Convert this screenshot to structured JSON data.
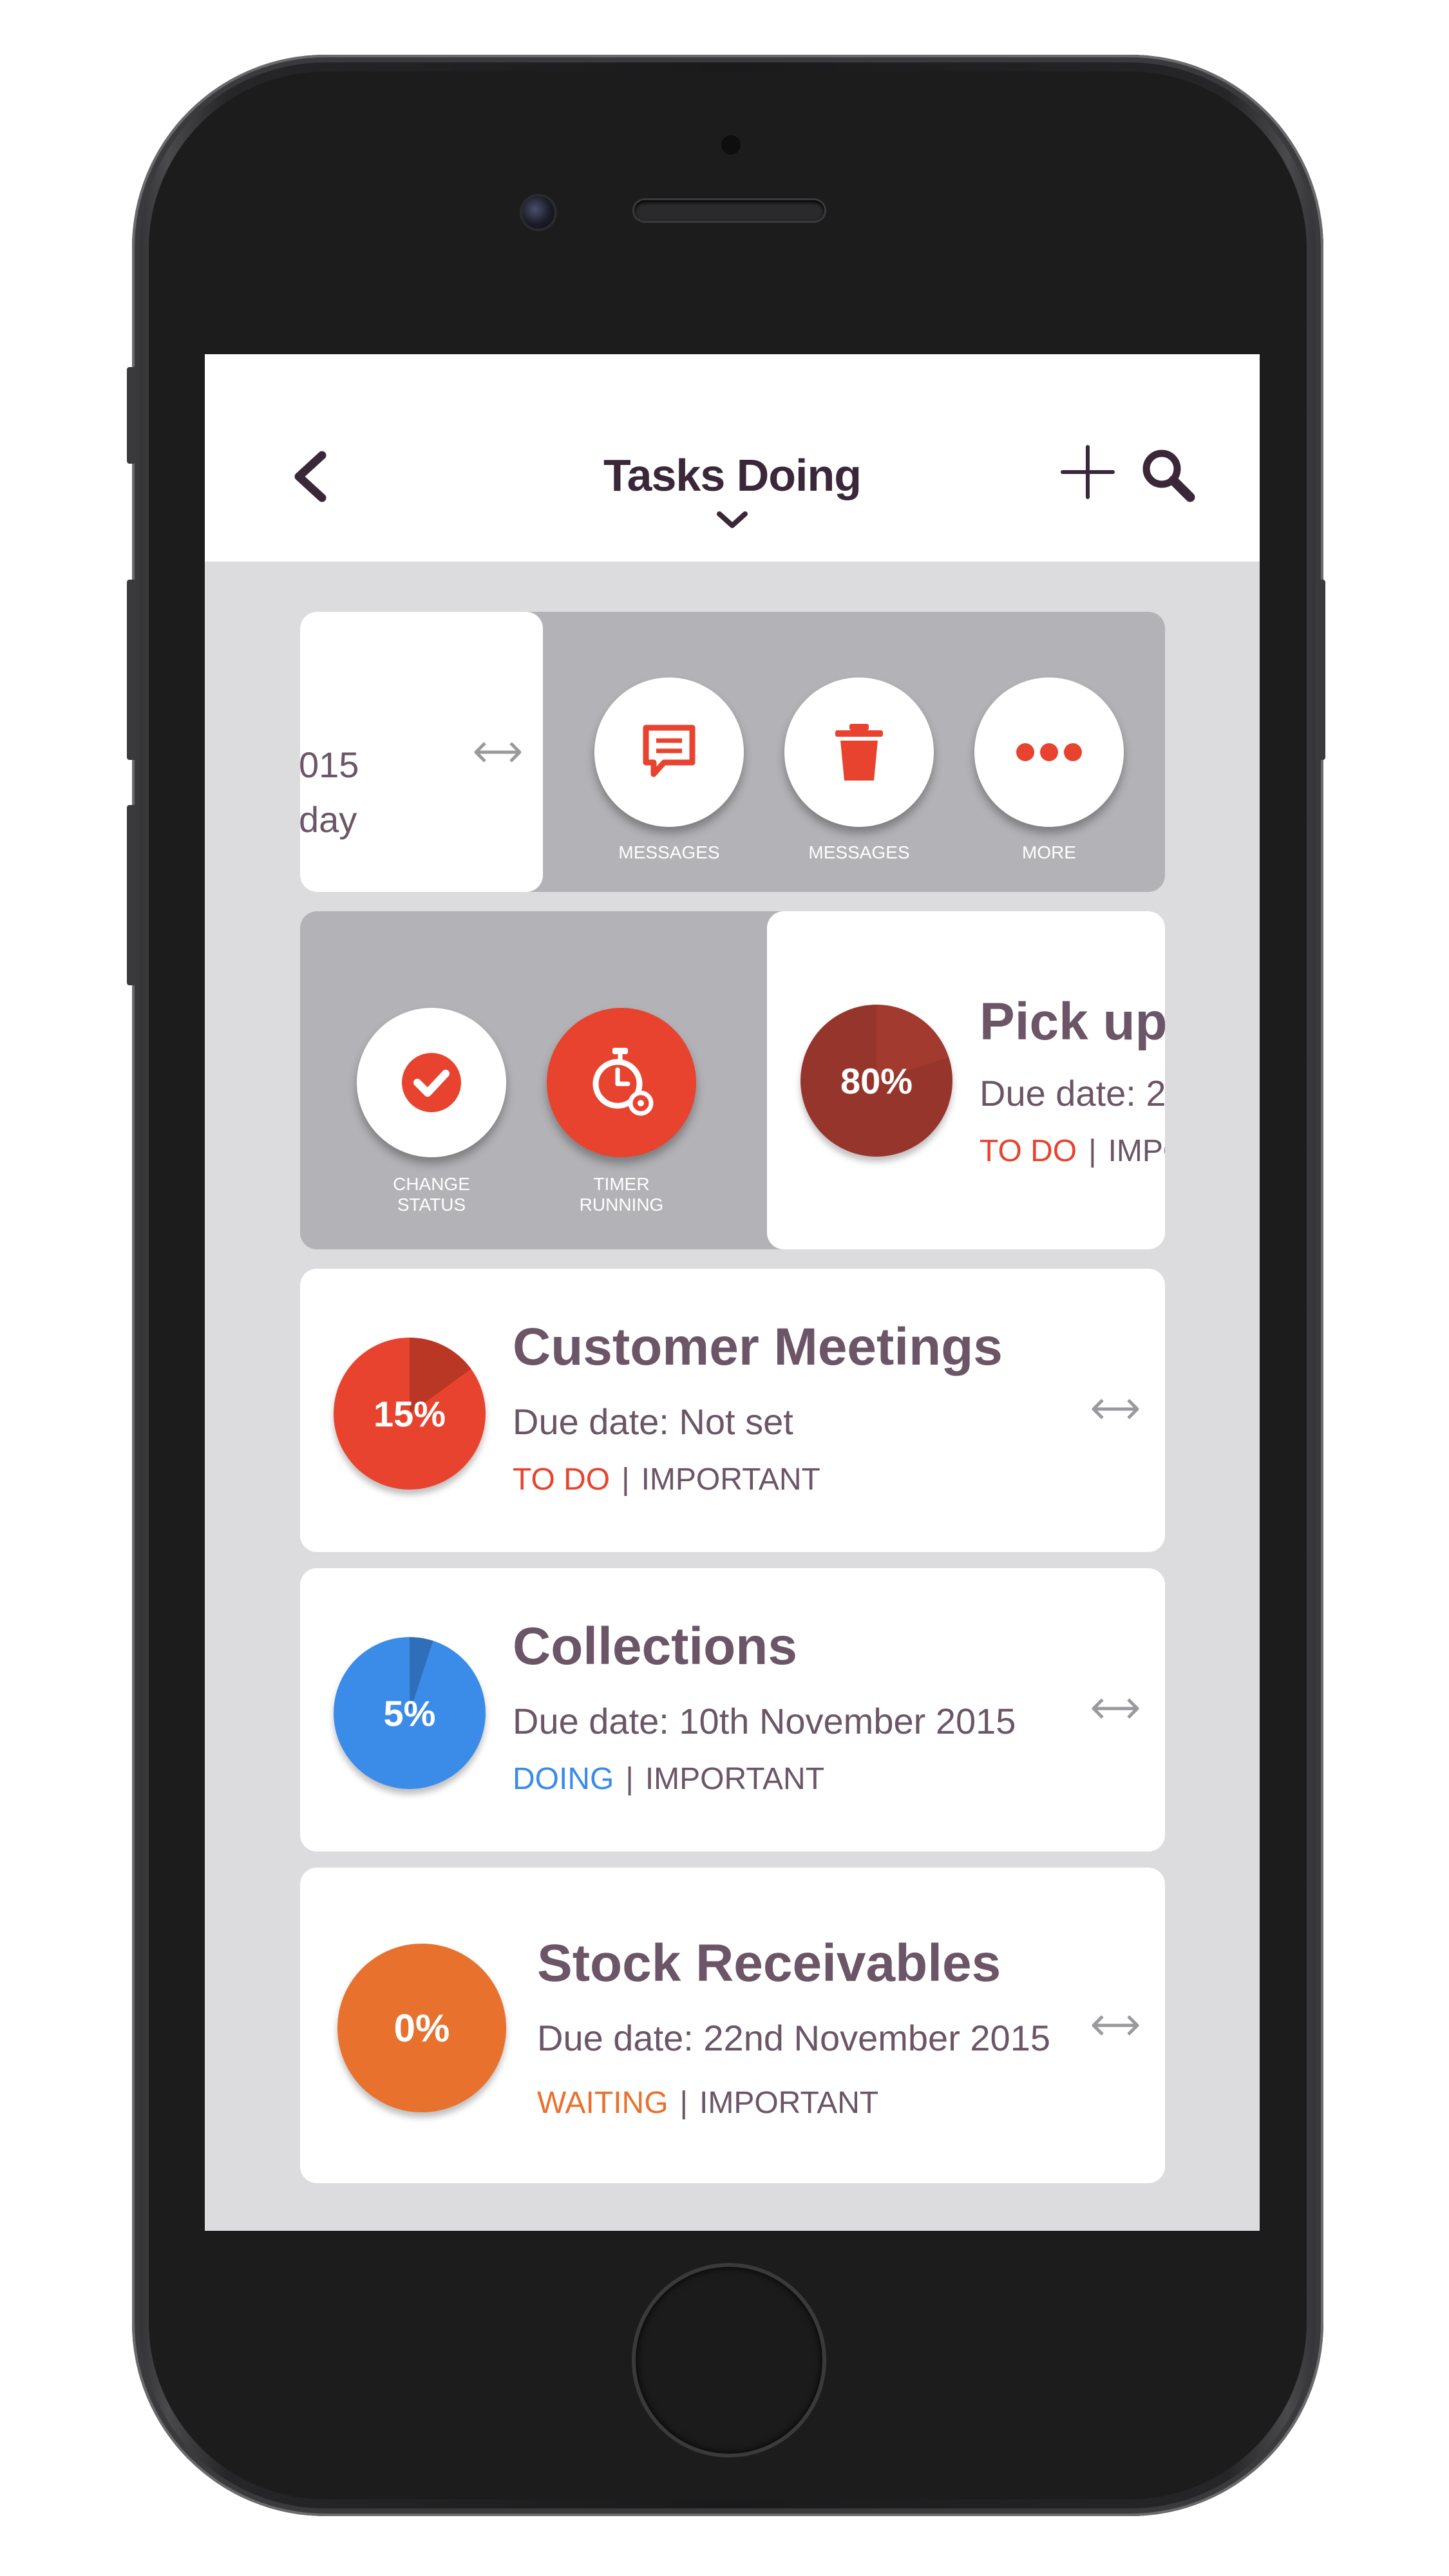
{
  "header": {
    "title": "Tasks Doing"
  },
  "colors": {
    "red": "#e8432e",
    "blue": "#3b8be8",
    "orange": "#e8712e",
    "dark_red": "#a33a30",
    "text": "#6b5566",
    "background": "#dcdcde"
  },
  "partial_card": {
    "date_fragment": "015",
    "day_fragment": "day",
    "actions": [
      {
        "label": "MESSAGES",
        "icon": "message-icon"
      },
      {
        "label": "MESSAGES",
        "icon": "trash-icon"
      },
      {
        "label": "MORE",
        "icon": "more-icon"
      }
    ]
  },
  "swiped_card": {
    "title": "Pick up",
    "due": "Due date: 2",
    "status": "TO DO",
    "priority": "IMPO",
    "progress_label": "80%",
    "progress": 0.8,
    "actions": [
      {
        "label_1": "CHANGE",
        "label_2": "STATUS",
        "icon": "check-icon"
      },
      {
        "label_1": "TIMER",
        "label_2": "RUNNING",
        "icon": "timer-icon"
      }
    ]
  },
  "tasks": [
    {
      "title": "Customer Meetings",
      "due": "Due date: Not set",
      "status": "TO DO",
      "priority": "IMPORTANT",
      "progress_label": "15%",
      "progress": 0.15,
      "color": "#e8432e"
    },
    {
      "title": "Collections",
      "due": "Due date: 10th November 2015",
      "status": "DOING",
      "priority": "IMPORTANT",
      "progress_label": "5%",
      "progress": 0.05,
      "color": "#3b8be8"
    },
    {
      "title": "Stock Receivables",
      "due": "Due date: 22nd November 2015",
      "status": "WAITING",
      "priority": "IMPORTANT",
      "progress_label": "0%",
      "progress": 0,
      "color": "#e8712e"
    }
  ]
}
